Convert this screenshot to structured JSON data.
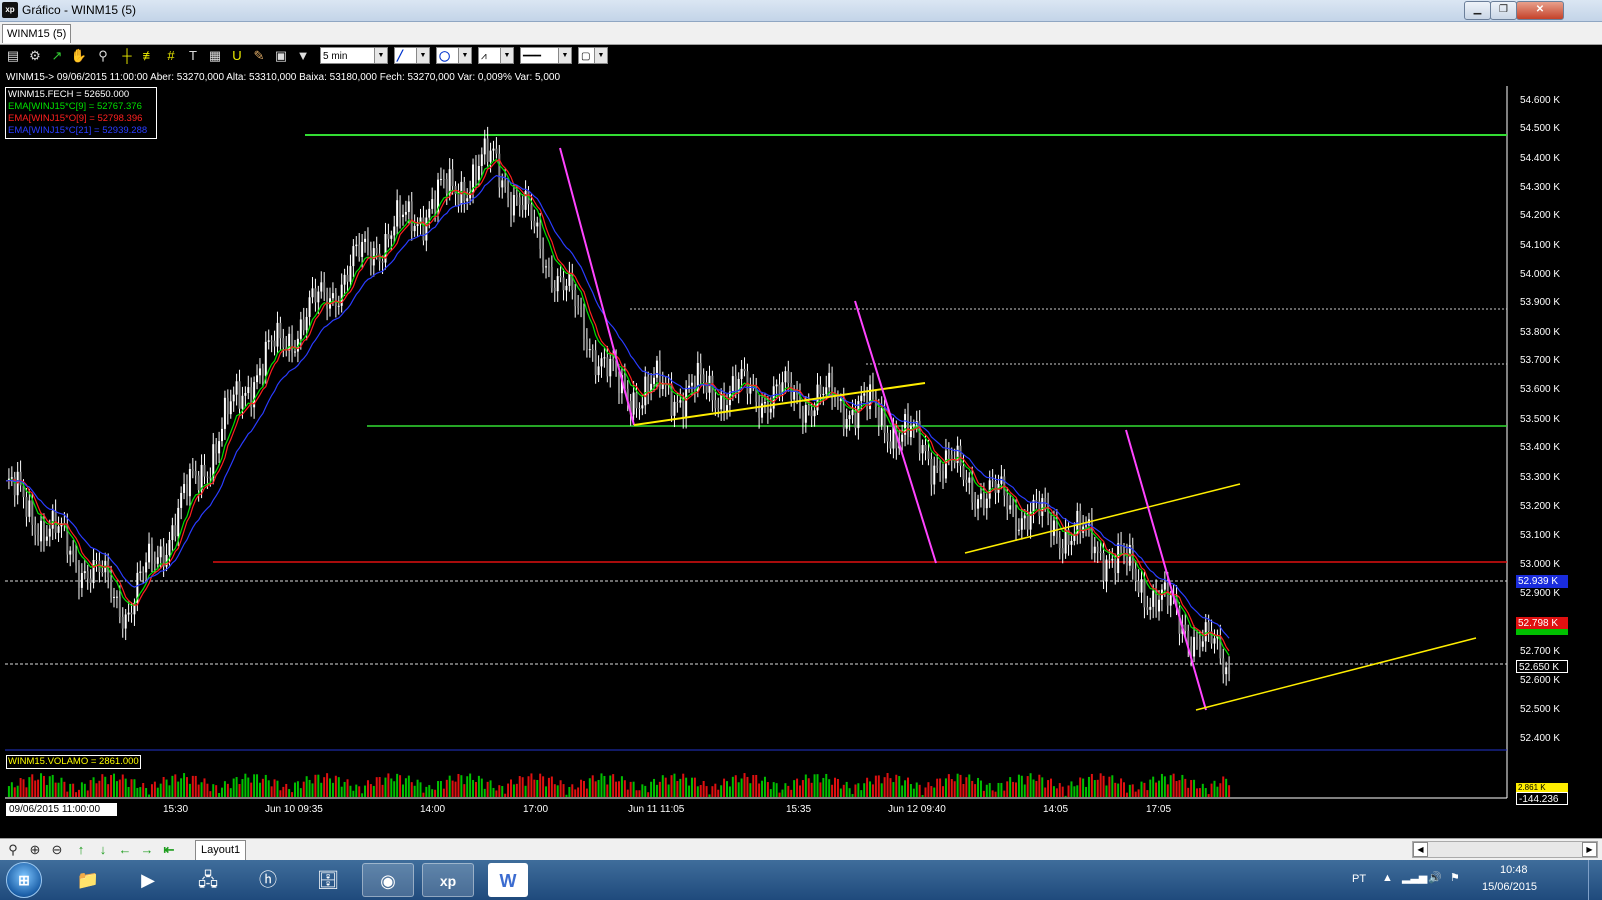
{
  "window": {
    "title": "Gráfico - WINM15 (5)",
    "icon": "xp"
  },
  "tab": {
    "label": "WINM15 (5)"
  },
  "toolbar": {
    "interval": "5 min",
    "icons": [
      "chart-icon",
      "gear-icon",
      "line-icon",
      "hand-icon",
      "zoom-icon",
      "crosshair-icon",
      "parallel-icon",
      "grid-icon",
      "text-icon",
      "horseshoe-icon",
      "brush-icon",
      "calculator-icon",
      "paste-icon",
      "filter-icon"
    ]
  },
  "chart_info": "WINM15-> 09/06/2015 11:00:00 Aber: 53270,000 Alta: 53310,000 Baixa: 53180,000 Fech: 53270,000 Var: 0,009% Var: 5,000",
  "legend": [
    {
      "text": "WINM15.FECH = 52650.000",
      "color": "#ffffff"
    },
    {
      "text": "EMA[WINJ15*C[9] = 52767.376",
      "color": "#00e000"
    },
    {
      "text": "EMA[WINJ15*O[9] = 52798.396",
      "color": "#ff2020"
    },
    {
      "text": "EMA[WINJ15*C[21] = 52939.288",
      "color": "#2a3cff"
    }
  ],
  "volume_label": "WINM15.VOLAMO = 2861.000",
  "cursor_date": "09/06/2015 11:00:00",
  "x_labels": [
    "15:30",
    "Jun 10 09:35",
    "14:00",
    "17:00",
    "Jun 11 11:05",
    "15:35",
    "Jun 12 09:40",
    "14:05",
    "17:05"
  ],
  "y_labels": [
    "54.600 K",
    "54.500 K",
    "54.400 K",
    "54.300 K",
    "54.200 K",
    "54.100 K",
    "54.000 K",
    "53.900 K",
    "53.800 K",
    "53.700 K",
    "53.600 K",
    "53.500 K",
    "53.400 K",
    "53.300 K",
    "53.200 K",
    "53.100 K",
    "53.000 K",
    "52.900 K",
    "52.700 K",
    "52.600 K",
    "52.500 K",
    "52.400 K"
  ],
  "price_boxes": {
    "ema21": "52.939 K",
    "ema_open": "52.798 K",
    "last": "52.650 K",
    "vol_top": "2.861 K",
    "vol_bottom": "-144.236"
  },
  "colors": {
    "ema_close_9": "#00e000",
    "ema_open_9": "#ff2020",
    "ema_close_21": "#2a3cff",
    "support": "#33dd33",
    "resistance_red": "#e01010",
    "trend_yellow": "#ffee00",
    "trend_magenta": "#ff44ff"
  },
  "bottom": {
    "layout_tab": "Layout1"
  },
  "taskbar": {
    "apps": [
      "explorer",
      "media-player",
      "network",
      "hp",
      "archive",
      "chrome",
      "xp",
      "word"
    ],
    "lang": "PT",
    "time": "10:48",
    "date": "15/06/2015"
  },
  "chart_data": {
    "type": "line",
    "title": "",
    "y_range": [
      52350,
      54650
    ],
    "series": [
      {
        "name": "WINM15.FECH",
        "type": "candlestick",
        "x": [
          "Jun 09 11:00",
          "Jun 09 15:30",
          "Jun 10 09:35",
          "Jun 10 14:00",
          "Jun 10 17:00",
          "Jun 11 11:05",
          "Jun 11 15:35",
          "Jun 12 09:40",
          "Jun 12 14:05",
          "Jun 12 17:05",
          "Jun 12 18:10"
        ],
        "values": [
          53270,
          52850,
          53650,
          54100,
          54400,
          53600,
          53600,
          53550,
          53250,
          53050,
          52650
        ]
      },
      {
        "name": "EMA[WINJ15*C[9]",
        "last": 52767.376
      },
      {
        "name": "EMA[WINJ15*O[9]",
        "last": 52798.396
      },
      {
        "name": "EMA[WINJ15*C[21]",
        "last": 52939.288
      }
    ],
    "horizontal_lines": [
      54480,
      53490,
      53010,
      52939,
      53890,
      53700,
      52650
    ],
    "volume": {
      "last": 2861,
      "range": [
        -144.236,
        2861
      ]
    }
  }
}
